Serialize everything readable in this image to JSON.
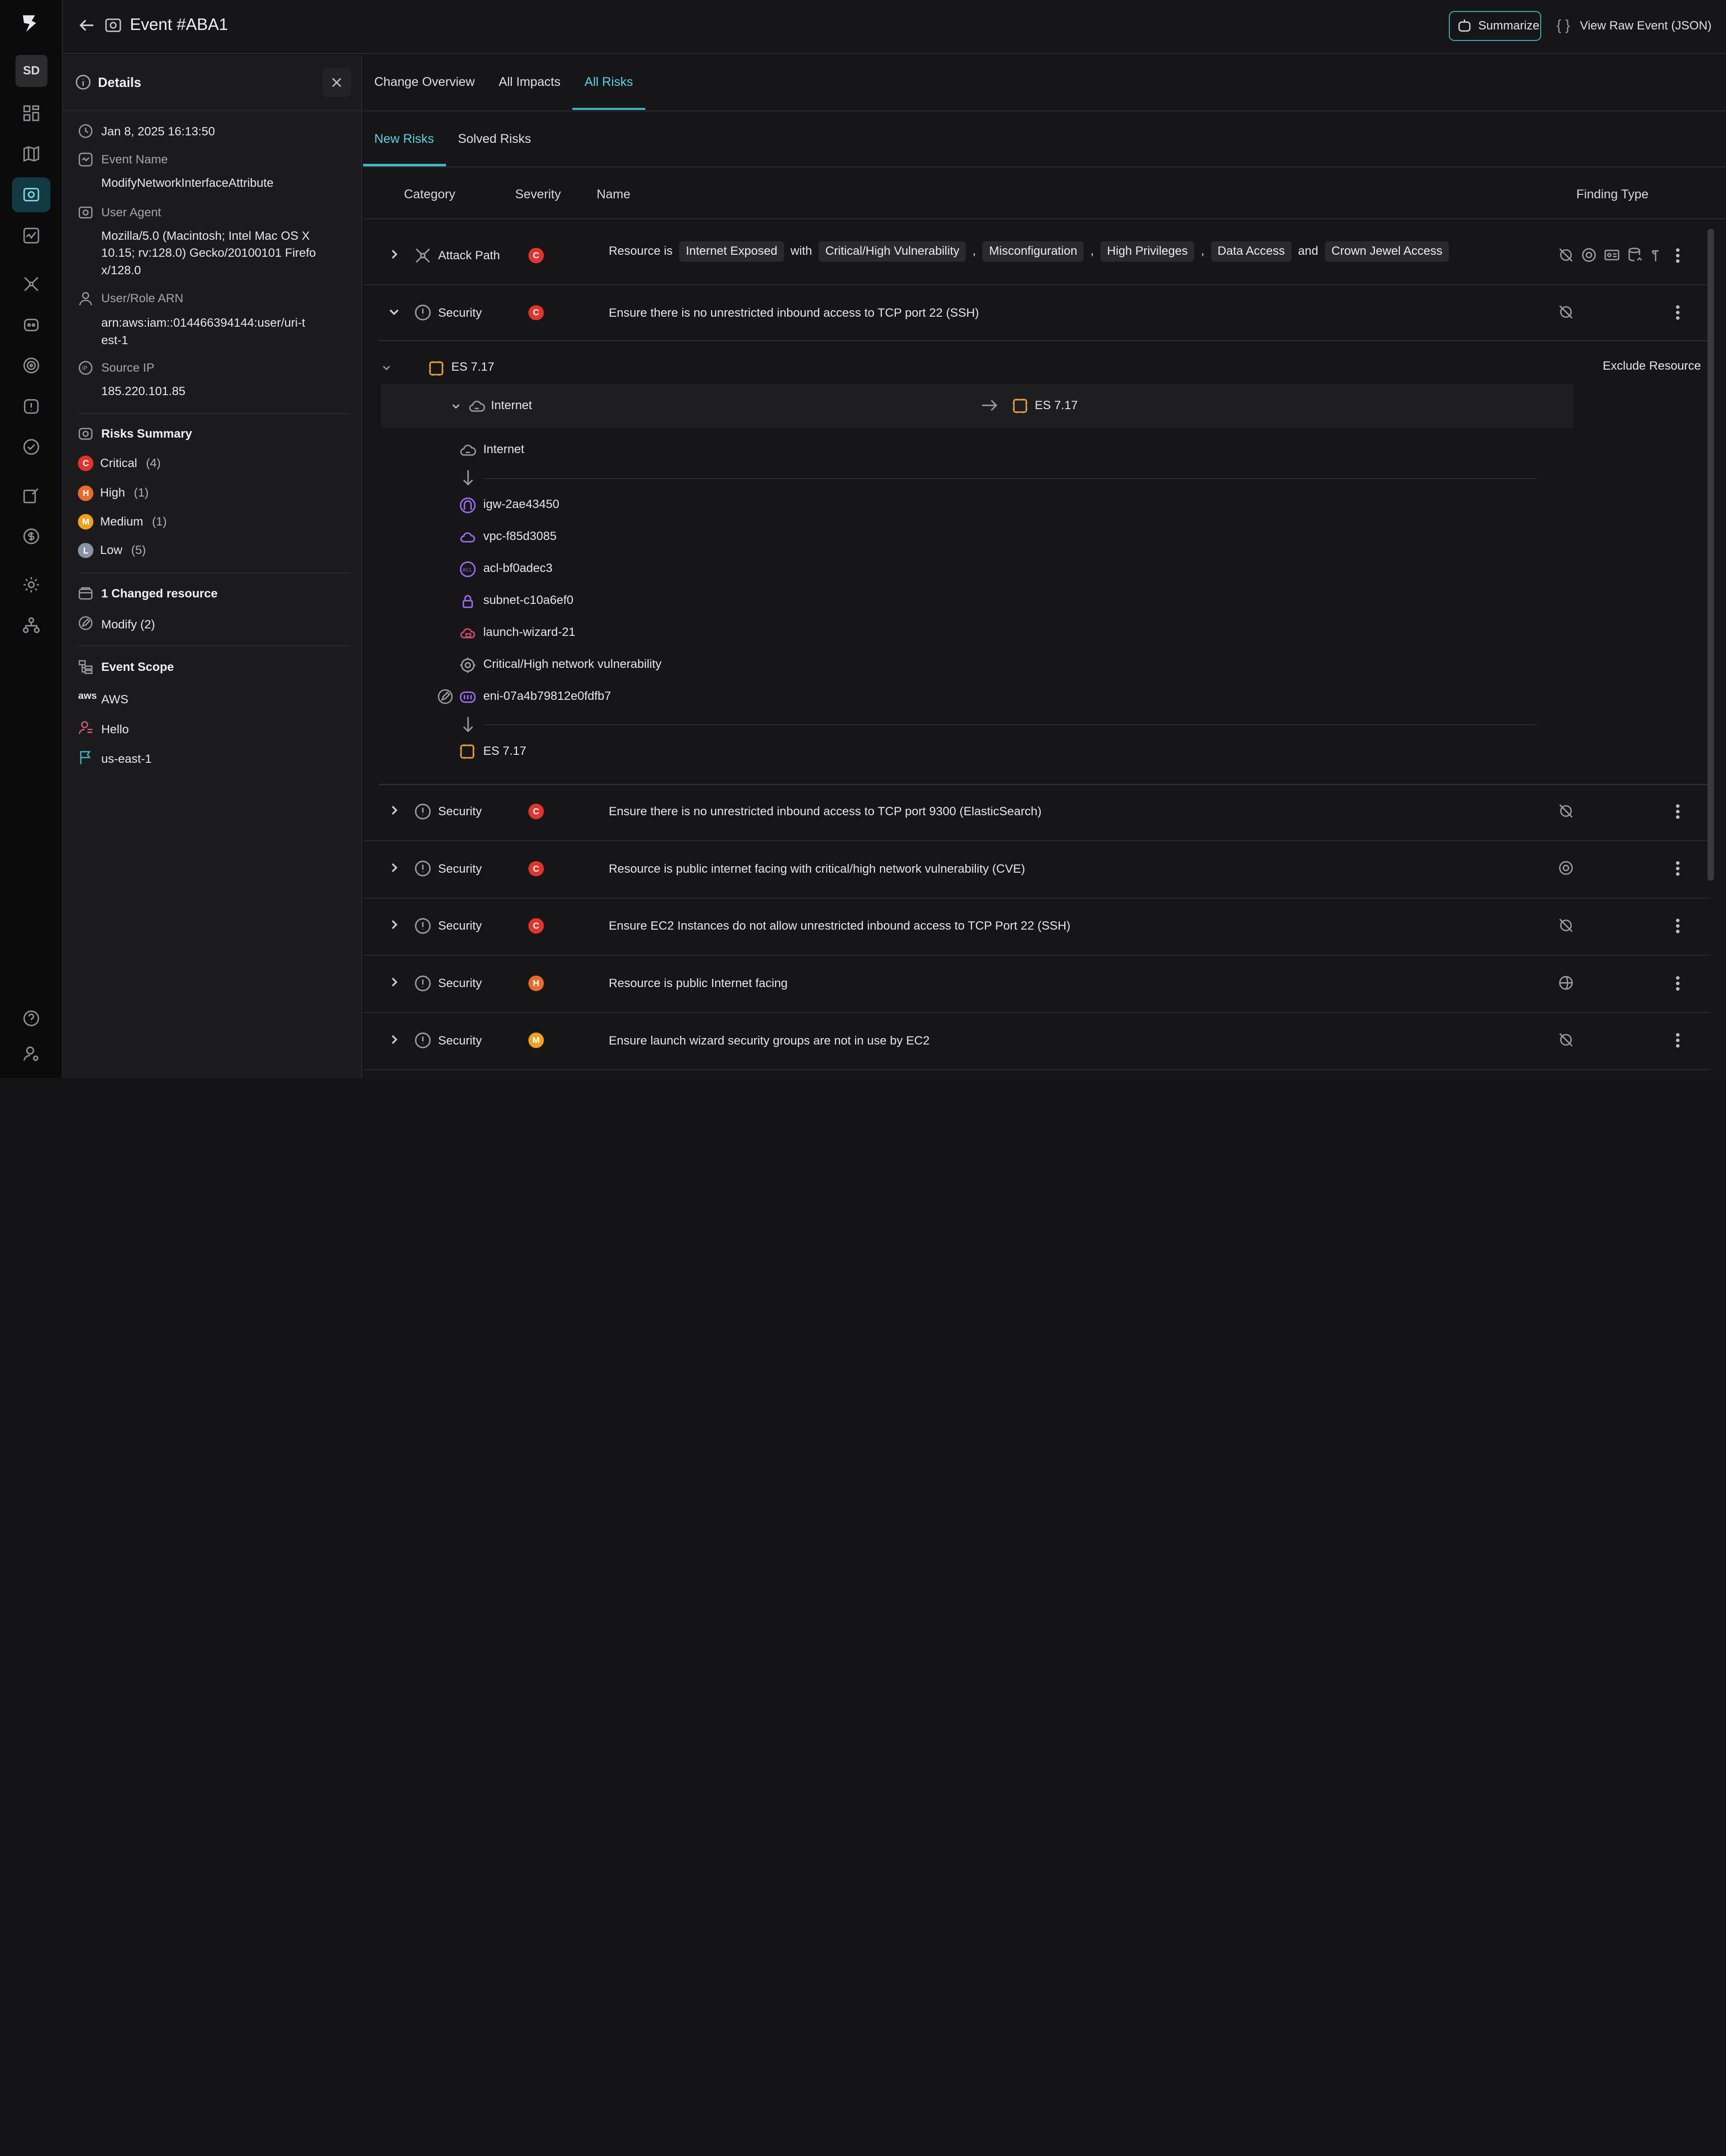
{
  "topbar": {
    "title": "Event #ABA1",
    "summarize": "Summarize",
    "view_raw": "View Raw Event (JSON)"
  },
  "rail": {
    "avatar": "SD",
    "items": [
      "dashboard-icon",
      "map-icon",
      "events-icon",
      "activity-icon",
      "graph-icon",
      "robot-icon",
      "target-icon",
      "shield-icon",
      "check-icon",
      "edit-doc-icon",
      "dollar-icon",
      "settings-icon",
      "org-icon",
      "help-icon",
      "user-settings-icon"
    ]
  },
  "details": {
    "title": "Details",
    "timestamp": "Jan 8, 2025 16:13:50",
    "event_name_label": "Event Name",
    "event_name": "ModifyNetworkInterfaceAttribute",
    "user_agent_label": "User Agent",
    "user_agent_lines": [
      "Mozilla/5.0 (Macintosh; Intel Mac OS X",
      "10.15; rv:128.0) Gecko/20100101 Firefo",
      "x/128.0"
    ],
    "arn_label": "User/Role ARN",
    "arn_lines": [
      "arn:aws:iam::014466394144:user/uri-t",
      "est-1"
    ],
    "source_ip_label": "Source IP",
    "source_ip": "185.220.101.85",
    "risks_summary_label": "Risks Summary",
    "risks": [
      {
        "letter": "C",
        "label": "Critical",
        "count": "(4)",
        "color": "#e0342f"
      },
      {
        "letter": "H",
        "label": "High",
        "count": "(1)",
        "color": "#e86b2e"
      },
      {
        "letter": "M",
        "label": "Medium",
        "count": "(1)",
        "color": "#f0a020"
      },
      {
        "letter": "L",
        "label": "Low",
        "count": "(5)",
        "color": "#8a93a6"
      }
    ],
    "changed_label": "1 Changed resource",
    "modify_label": "Modify (2)",
    "scope_label": "Event Scope",
    "scope": [
      "AWS",
      "Hello",
      "us-east-1"
    ]
  },
  "tabs": [
    "Change Overview",
    "All Impacts",
    "All Risks"
  ],
  "subtabs": [
    "New Risks",
    "Solved Risks"
  ],
  "columns": {
    "category": "Category",
    "severity": "Severity",
    "name": "Name",
    "finding_type": "Finding Type"
  },
  "attack_row": {
    "category": "Attack Path",
    "severity": "C",
    "prefix": "Resource is",
    "tags": [
      "Internet Exposed",
      "Critical/High Vulnerability",
      "Misconfiguration",
      "High Privileges",
      "Data Access",
      "Crown Jewel Access"
    ],
    "with": "with",
    "comma": ",",
    "and": "and"
  },
  "expanded_row": {
    "category": "Security",
    "severity": "C",
    "name": "Ensure there is no unrestricted inbound access to TCP port 22 (SSH)"
  },
  "path": {
    "resource": "ES 7.17",
    "exclude": "Exclude Resource",
    "from": "Internet",
    "to": "ES 7.17",
    "nodes": [
      "Internet",
      "igw-2ae43450",
      "vpc-f85d3085",
      "acl-bf0adec3",
      "subnet-c10a6ef0",
      "launch-wizard-21",
      "Critical/High network vulnerability",
      "eni-07a4b79812e0fdfb7",
      "ES 7.17"
    ]
  },
  "rows": [
    {
      "category": "Security",
      "severity": "C",
      "name": "Ensure there is no unrestricted inbound access to TCP port 9300 (ElasticSearch)"
    },
    {
      "category": "Security",
      "severity": "C",
      "name": "Resource is public internet facing with critical/high network vulnerability (CVE)"
    },
    {
      "category": "Security",
      "severity": "C",
      "name": "Ensure EC2 Instances do not allow unrestricted inbound access to TCP Port 22 (SSH)"
    },
    {
      "category": "Security",
      "severity": "H",
      "name": "Resource is public Internet facing"
    },
    {
      "category": "Security",
      "severity": "M",
      "name": "Ensure launch wizard security groups are not in use by EC2"
    }
  ],
  "colors": {
    "accent": "#3fb8c8",
    "critical": "#e0342f",
    "high": "#e86b2e",
    "medium": "#f0a020",
    "low": "#8a93a6",
    "aws_orange": "#e6a23c",
    "node_purple": "#9b6bf0"
  }
}
